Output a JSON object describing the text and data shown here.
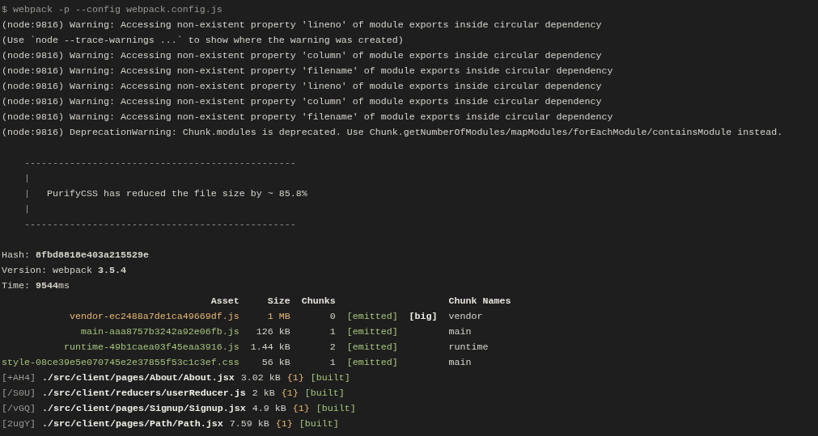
{
  "command": "$ webpack -p --config webpack.config.js",
  "log_lines": [
    "(node:9816) Warning: Accessing non-existent property 'lineno' of module exports inside circular dependency",
    "(Use `node --trace-warnings ...` to show where the warning was created)",
    "(node:9816) Warning: Accessing non-existent property 'column' of module exports inside circular dependency",
    "(node:9816) Warning: Accessing non-existent property 'filename' of module exports inside circular dependency",
    "(node:9816) Warning: Accessing non-existent property 'lineno' of module exports inside circular dependency",
    "(node:9816) Warning: Accessing non-existent property 'column' of module exports inside circular dependency",
    "(node:9816) Warning: Accessing non-existent property 'filename' of module exports inside circular dependency",
    "(node:9816) DeprecationWarning: Chunk.modules is deprecated. Use Chunk.getNumberOfModules/mapModules/forEachModule/containsModule instead."
  ],
  "purify_box": {
    "rule_top": "------------------------------------------------",
    "bar_top": "|",
    "message_bar": "|",
    "message": "PurifyCSS has reduced the file size by ~ 85.8%",
    "bar_bottom": "|",
    "rule_bottom": "------------------------------------------------"
  },
  "stats": [
    "Hash: **8fbd8818e403a215529e**",
    "Version: webpack **3.5.4**",
    "Time: **9544**ms"
  ],
  "asset_table": {
    "columns": [
      "Asset",
      "Size",
      "Chunks",
      "Chunk Names"
    ],
    "rows": [
      {
        "asset": "vendor-ec2488a7de1ca49669df.js",
        "size": "1 MB",
        "chunks": "0",
        "status": "[emitted]",
        "flag": "[big]",
        "chunk_names": "vendor",
        "warn": true
      },
      {
        "asset": "main-aaa8757b3242a92e06fb.js",
        "size": "126 kB",
        "chunks": "1",
        "status": "[emitted]",
        "chunk_names": "main",
        "warn": false
      },
      {
        "asset": "runtime-49b1caea03f45eaa3916.js",
        "size": "1.44 kB",
        "chunks": "2",
        "status": "[emitted]",
        "chunk_names": "runtime",
        "warn": false
      },
      {
        "asset": "style-08ce39e5e070745e2e37855f53c1c3ef.css",
        "size": "56 kB",
        "chunks": "1",
        "status": "[emitted]",
        "chunk_names": "main",
        "warn": false
      }
    ]
  },
  "modules": [
    {
      "id": "[+AH4]",
      "path": "./src/client/pages/About/About.jsx",
      "size": "3.02 kB",
      "chunk": "{1}",
      "status": "[built]"
    },
    {
      "id": "[/S0U]",
      "path": "./src/client/reducers/userReducer.js",
      "size": "2 kB",
      "chunk": "{1}",
      "status": "[built]"
    },
    {
      "id": "[/vGQ]",
      "path": "./src/client/pages/Signup/Signup.jsx",
      "size": "4.9 kB",
      "chunk": "{1}",
      "status": "[built]"
    },
    {
      "id": "[2ugY]",
      "path": "./src/client/pages/Path/Path.jsx",
      "size": "7.59 kB",
      "chunk": "{1}",
      "status": "[built]"
    }
  ]
}
